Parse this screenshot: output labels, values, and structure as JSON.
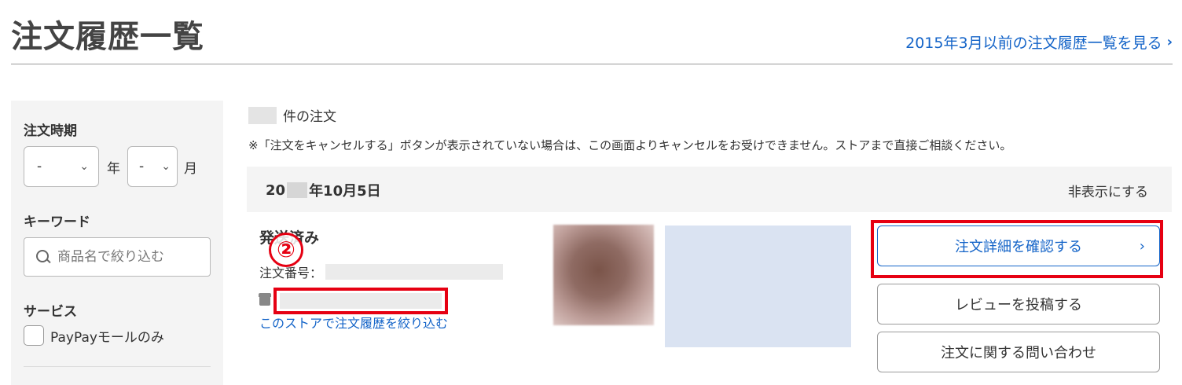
{
  "page": {
    "title": "注文履歴一覧",
    "old_history_link": "2015年3月以前の注文履歴一覧を見る",
    "link_chevron": "›"
  },
  "sidebar": {
    "period_label": "注文時期",
    "year_select_value": "-",
    "year_unit": "年",
    "month_select_value": "-",
    "month_unit": "月",
    "keyword_label": "キーワード",
    "keyword_placeholder": "商品名で絞り込む",
    "service_label": "サービス",
    "paypay_only_label": "PayPayモールのみ",
    "paypay_only_checked": false
  },
  "results": {
    "count_suffix": "件の注文",
    "notice": "※「注文をキャンセルする」ボタンが表示されていない場合は、この画面よりキャンセルをお受けできません。ストアまで直接ご相談ください。"
  },
  "order": {
    "date_prefix": "20",
    "date_suffix": "年10月5日",
    "hide_label": "非表示にする",
    "status": "発送済み",
    "order_number_label": "注文番号：",
    "store_filter_link": "このストアで注文履歴を絞り込む",
    "step_marker": "②",
    "buttons": {
      "detail": "注文詳細を確認する",
      "detail_chevron": "›",
      "review": "レビューを投稿する",
      "inquiry": "注文に関する問い合わせ"
    }
  },
  "colors": {
    "link_blue": "#1464c8",
    "highlight_red": "#e60012",
    "panel_gray": "#f4f4f4"
  },
  "icons": {
    "search": "search-icon",
    "store": "store-icon",
    "chevron": "chevron-right-icon",
    "dropdown": "chevron-down-icon"
  }
}
